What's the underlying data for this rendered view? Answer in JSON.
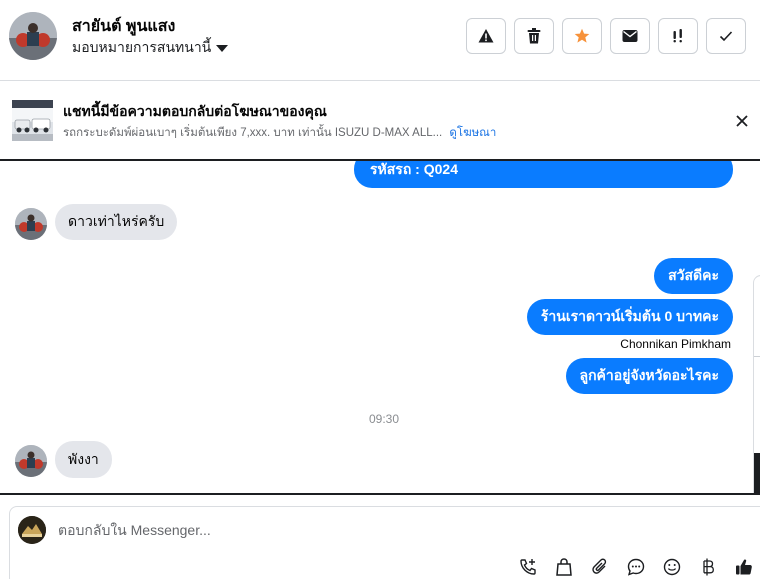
{
  "contact": {
    "name": "สายันต์ พูนแสง",
    "assign_label": "มอบหมายการสนทนานี้"
  },
  "header_actions": [
    {
      "icon": "alert-triangle-icon",
      "title": "spam"
    },
    {
      "icon": "trash-icon",
      "title": "delete"
    },
    {
      "icon": "star-icon",
      "title": "star"
    },
    {
      "icon": "envelope-icon",
      "title": "unread"
    },
    {
      "icon": "follow-up-icon",
      "title": "follow-up"
    },
    {
      "icon": "checkmark-icon",
      "title": "done"
    }
  ],
  "ad": {
    "title": "แชทนี้มีข้อความตอบกลับต่อโฆษณาของคุณ",
    "subtitle": "รถกระบะดัมพ์ผ่อนเบาๆ เริ่มต้นเพียง 7,xxx. บาท เท่านั้น ISUZU D-MAX ALL...",
    "link": "ดูโฆษณา"
  },
  "messages": {
    "out_code": "รหัสรถ : Q024",
    "in_1": "ดาวเท่าไหร่ครับ",
    "out_1": "สวัสดีคะ",
    "out_2": "ร้านเราดาวน์เริ่มต้น 0 บาทคะ",
    "sender_name": "Chonnikan Pimkham",
    "out_3": "ลูกค้าอยู่จังหวัดอะไรคะ",
    "timestamp": "09:30",
    "in_2": "พังงา"
  },
  "composer": {
    "placeholder": "ตอบกลับใน Messenger..."
  },
  "colors": {
    "outgoing_bubble": "#0a7cff",
    "incoming_bubble": "#e4e6eb",
    "link": "#1b74e4",
    "star": "#f7923b"
  }
}
